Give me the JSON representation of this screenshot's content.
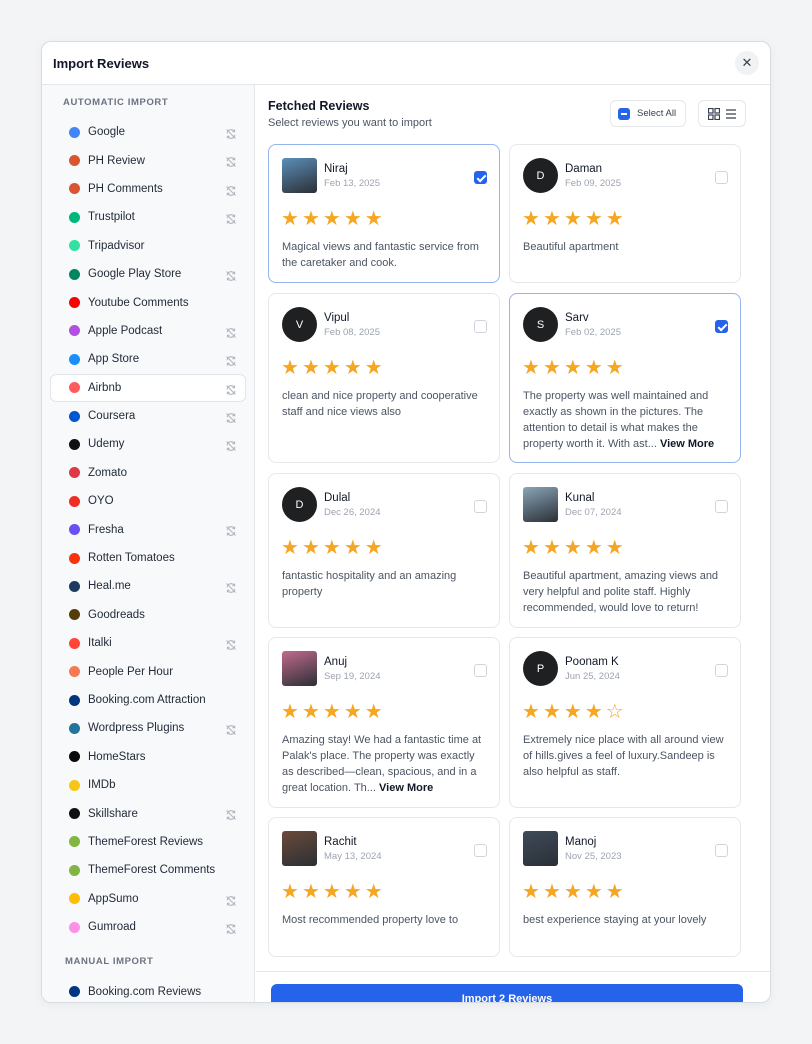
{
  "modal": {
    "title": "Import Reviews",
    "close_label": "✕"
  },
  "sidebar": {
    "automatic_title": "AUTOMATIC IMPORT",
    "manual_title": "MANUAL IMPORT",
    "items": [
      {
        "label": "Google",
        "icon": "google-icon",
        "color": "#4285f4",
        "sync": true
      },
      {
        "label": "PH Review",
        "icon": "producthunt-icon",
        "color": "#da552f",
        "sync": true
      },
      {
        "label": "PH Comments",
        "icon": "producthunt-icon",
        "color": "#da552f",
        "sync": true
      },
      {
        "label": "Trustpilot",
        "icon": "trustpilot-icon",
        "color": "#00b67a",
        "sync": true
      },
      {
        "label": "Tripadvisor",
        "icon": "tripadvisor-icon",
        "color": "#34e0a1",
        "sync": false
      },
      {
        "label": "Google Play Store",
        "icon": "playstore-icon",
        "color": "#01875f",
        "sync": true
      },
      {
        "label": "Youtube Comments",
        "icon": "youtube-icon",
        "color": "#ff0000",
        "sync": false
      },
      {
        "label": "Apple Podcast",
        "icon": "podcast-icon",
        "color": "#b150e2",
        "sync": true
      },
      {
        "label": "App Store",
        "icon": "appstore-icon",
        "color": "#1c8ef9",
        "sync": true
      },
      {
        "label": "Airbnb",
        "icon": "airbnb-icon",
        "color": "#ff5a5f",
        "sync": true
      },
      {
        "label": "Coursera",
        "icon": "coursera-icon",
        "color": "#0056d2",
        "sync": true
      },
      {
        "label": "Udemy",
        "icon": "udemy-icon",
        "color": "#111111",
        "sync": true
      },
      {
        "label": "Zomato",
        "icon": "zomato-icon",
        "color": "#e23744",
        "sync": false
      },
      {
        "label": "OYO",
        "icon": "oyo-icon",
        "color": "#ee2e24",
        "sync": false
      },
      {
        "label": "Fresha",
        "icon": "fresha-icon",
        "color": "#6950f3",
        "sync": true
      },
      {
        "label": "Rotten Tomatoes",
        "icon": "rottentomatoes-icon",
        "color": "#fa320a",
        "sync": false
      },
      {
        "label": "Heal.me",
        "icon": "healme-icon",
        "color": "#1e3a5f",
        "sync": true
      },
      {
        "label": "Goodreads",
        "icon": "goodreads-icon",
        "color": "#553b08",
        "sync": false
      },
      {
        "label": "Italki",
        "icon": "italki-icon",
        "color": "#ff4438",
        "sync": true
      },
      {
        "label": "People Per Hour",
        "icon": "peopleperhour-icon",
        "color": "#f47b53",
        "sync": false
      },
      {
        "label": "Booking.com Attraction",
        "icon": "booking-icon",
        "color": "#003580",
        "sync": false
      },
      {
        "label": "Wordpress Plugins",
        "icon": "wordpress-icon",
        "color": "#21759b",
        "sync": true
      },
      {
        "label": "HomeStars",
        "icon": "homestars-icon",
        "color": "#0a0a0a",
        "sync": false
      },
      {
        "label": "IMDb",
        "icon": "imdb-icon",
        "color": "#f5c518",
        "sync": false
      },
      {
        "label": "Skillshare",
        "icon": "skillshare-icon",
        "color": "#111111",
        "sync": true
      },
      {
        "label": "ThemeForest Reviews",
        "icon": "themeforest-icon",
        "color": "#82b541",
        "sync": false
      },
      {
        "label": "ThemeForest Comments",
        "icon": "themeforest-icon",
        "color": "#82b541",
        "sync": false
      },
      {
        "label": "AppSumo",
        "icon": "appsumo-icon",
        "color": "#ffbc00",
        "sync": true
      },
      {
        "label": "Gumroad",
        "icon": "gumroad-icon",
        "color": "#ff90e8",
        "sync": true
      }
    ],
    "active_index": 9,
    "manual_items": [
      {
        "label": "Booking.com Reviews",
        "icon": "booking-icon",
        "color": "#003580"
      }
    ]
  },
  "main": {
    "title": "Fetched Reviews",
    "subtitle": "Select reviews you want to import",
    "select_all_label": "Select All",
    "import_button_label": "Import 2 Reviews",
    "more_label": "View More"
  },
  "reviews": [
    {
      "name": "Niraj",
      "date": "Feb 13, 2025",
      "avatar": "photo",
      "initial": "",
      "rating": 5,
      "selected": true,
      "text": "Magical views and fantastic service from the caretaker and cook.",
      "truncated": false
    },
    {
      "name": "Daman",
      "date": "Feb 09, 2025",
      "avatar": "initial",
      "initial": "D",
      "rating": 5,
      "selected": false,
      "text": "Beautiful apartment",
      "truncated": false
    },
    {
      "name": "Vipul",
      "date": "Feb 08, 2025",
      "avatar": "initial",
      "initial": "V",
      "rating": 5,
      "selected": false,
      "text": "clean and nice property and cooperative staff and nice views also",
      "truncated": false
    },
    {
      "name": "Sarv",
      "date": "Feb 02, 2025",
      "avatar": "initial",
      "initial": "S",
      "rating": 5,
      "selected": true,
      "text": "The property was well maintained and exactly as shown in the pictures. The attention to detail is what makes the property worth it. With ast...",
      "truncated": true
    },
    {
      "name": "Dulal",
      "date": "Dec 26, 2024",
      "avatar": "initial",
      "initial": "D",
      "rating": 5,
      "selected": false,
      "text": "fantastic hospitality and an amazing property",
      "truncated": false
    },
    {
      "name": "Kunal",
      "date": "Dec 07, 2024",
      "avatar": "photo",
      "initial": "",
      "rating": 5,
      "selected": false,
      "text": "Beautiful apartment, amazing views and very helpful and polite staff. Highly recommended, would love to return!",
      "truncated": false
    },
    {
      "name": "Anuj",
      "date": "Sep 19, 2024",
      "avatar": "photo",
      "initial": "",
      "rating": 5,
      "selected": false,
      "text": "Amazing stay! We had a fantastic time at Palak's place. The property was exactly as described—clean, spacious, and in a great location. Th...",
      "truncated": true
    },
    {
      "name": "Poonam K",
      "date": "Jun 25, 2024",
      "avatar": "initial",
      "initial": "P",
      "rating": 4,
      "selected": false,
      "text": "Extremely nice place with all around view of hills.gives a feel of luxury.Sandeep is also helpful as staff.",
      "truncated": false
    },
    {
      "name": "Rachit",
      "date": "May 13, 2024",
      "avatar": "photo",
      "initial": "",
      "rating": 5,
      "selected": false,
      "text": "Most recommended property love to",
      "truncated": false
    },
    {
      "name": "Manoj",
      "date": "Nov 25, 2023",
      "avatar": "photo",
      "initial": "",
      "rating": 5,
      "selected": false,
      "text": "best experience staying at your lovely",
      "truncated": false
    }
  ]
}
